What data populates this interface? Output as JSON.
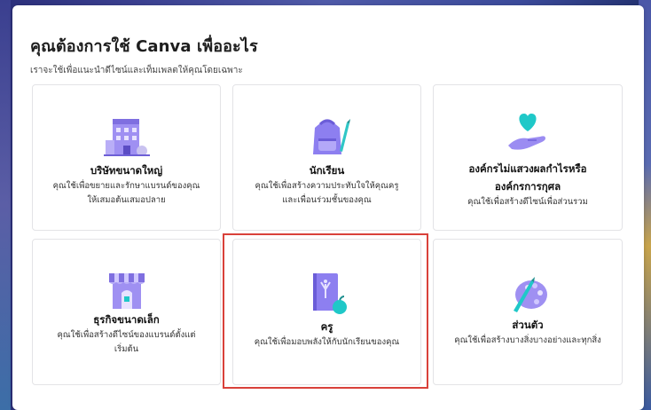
{
  "dialog": {
    "title": "คุณต้องการใช้ Canva เพื่ออะไร",
    "subtitle": "เราจะใช้เพื่อแนะนำดีไซน์และเท็มเพลตให้คุณโดยเฉพาะ"
  },
  "options": [
    {
      "title": "บริษัทขนาดใหญ่",
      "desc1": "คุณใช้เพื่อขยายและรักษาแบรนด์ของคุณ",
      "desc2": "ให้เสมอต้นเสมอปลาย",
      "icon": "office-building-icon"
    },
    {
      "title": "นักเรียน",
      "desc1": "คุณใช้เพื่อสร้างความประทับใจให้คุณครู",
      "desc2": "และเพื่อนร่วมชั้นของคุณ",
      "icon": "backpack-pencil-icon"
    },
    {
      "title1": "องค์กรไม่แสวงผลกำไรหรือ",
      "title2": "องค์กรการกุศล",
      "desc1": "คุณใช้เพื่อสร้างดีไซน์เพื่อส่วนรวม",
      "icon": "heart-hand-icon"
    },
    {
      "title": "ธุรกิจขนาดเล็ก",
      "desc1": "คุณใช้เพื่อสร้างดีไซน์ของแบรนด์ตั้งแต่",
      "desc2": "เริ่มต้น",
      "icon": "storefront-icon"
    },
    {
      "title": "ครู",
      "desc1": "คุณใช้เพื่อมอบพลังให้กับนักเรียนของคุณ",
      "icon": "book-apple-icon"
    },
    {
      "title": "ส่วนตัว",
      "desc1": "คุณใช้เพื่อสร้างบางสิ่งบางอย่างและทุกสิ่ง",
      "icon": "paint-palette-icon"
    }
  ],
  "colors": {
    "accent_purple": "#8b7cf0",
    "accent_teal": "#1fc8c8",
    "highlight_red": "#d9413a"
  }
}
